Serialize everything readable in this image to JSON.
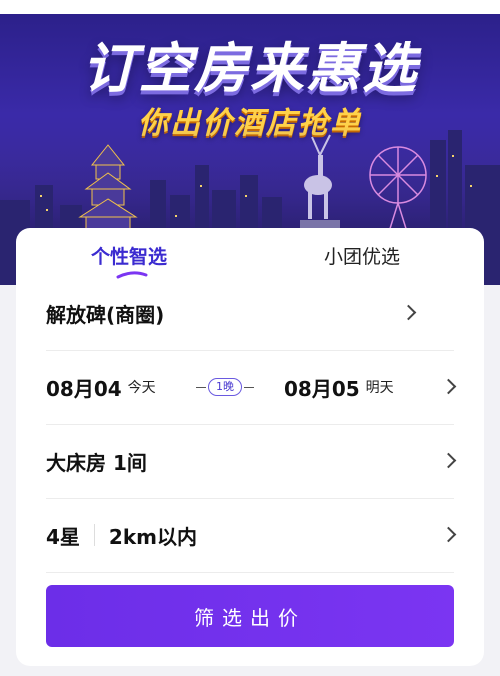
{
  "banner": {
    "title": "订空房来惠选",
    "subtitle": "你出价酒店抢单"
  },
  "tabs": [
    {
      "label": "个性智选",
      "active": true
    },
    {
      "label": "小团优选",
      "active": false
    }
  ],
  "location": {
    "value": "解放碑(商圈)"
  },
  "dates": {
    "checkin_date": "08月04",
    "checkin_day": "今天",
    "nights": "1晚",
    "checkout_date": "08月05",
    "checkout_day": "明天"
  },
  "room": {
    "value": "大床房 1间"
  },
  "filters": {
    "star": "4星",
    "distance": "2km以内"
  },
  "submit": {
    "label": "筛选出价"
  },
  "colors": {
    "accent": "#6c2ee8",
    "banner": "#3a2aa8",
    "subtitle": "#ffd24a"
  }
}
